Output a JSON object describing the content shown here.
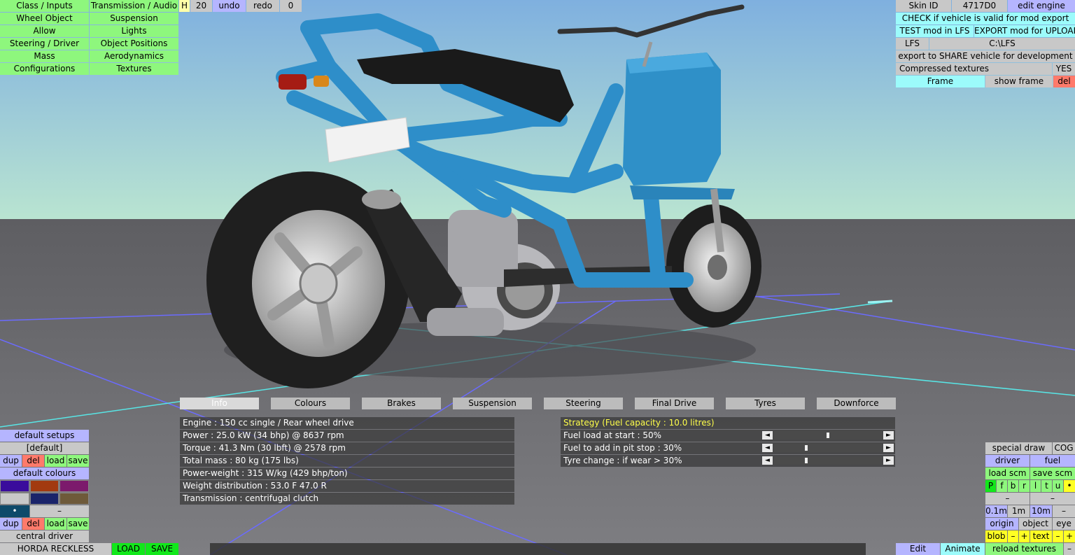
{
  "toolbar_left": {
    "rows": [
      [
        "Class / Inputs",
        "Transmission / Audio"
      ],
      [
        "Wheel Object",
        "Suspension"
      ],
      [
        "Allow",
        "Lights"
      ],
      [
        "Steering / Driver",
        "Object Positions"
      ],
      [
        "Mass",
        "Aerodynamics"
      ],
      [
        "Configurations",
        "Textures"
      ]
    ],
    "h_label": "H",
    "num_label": "20",
    "undo_label": "undo",
    "redo_label": "redo",
    "zero_label": "0"
  },
  "toolbar_right": {
    "skin_id_label": "Skin ID",
    "skin_id_value": "4717D0",
    "edit_engine": "edit engine",
    "check_valid": "CHECK if vehicle is valid for mod export",
    "test_mod": "TEST mod in LFS",
    "export_mod": "EXPORT mod for UPLOAD",
    "lfs_label": "LFS",
    "lfs_path": "C:\\LFS",
    "export_share": "export to SHARE vehicle for development",
    "compressed_textures": "Compressed textures",
    "compressed_value": "YES",
    "frame": "Frame",
    "show_frame": "show frame",
    "del": "del"
  },
  "info_tabs": [
    "Info",
    "Colours",
    "Brakes",
    "Suspension",
    "Steering",
    "Final Drive",
    "Tyres",
    "Downforce"
  ],
  "info_rows": [
    "Engine : 150 cc single / Rear wheel drive",
    "Power : 25.0 kW (34 bhp) @ 8637 rpm",
    "Torque : 41.3 Nm (30 lbft) @ 2578 rpm",
    "Total mass : 80 kg (175 lbs)",
    "Power-weight : 315 W/kg (429 bhp/ton)",
    "Weight distribution : 53.0 F  47.0 R",
    "Transmission : centrifugal clutch"
  ],
  "strategy": {
    "title": "Strategy (Fuel capacity : 10.0 litres)",
    "rows": [
      {
        "label": "Fuel load at start : 50%",
        "value": 0.5
      },
      {
        "label": "Fuel to add in pit stop : 30%",
        "value": 0.3
      },
      {
        "label": "Tyre change : if wear > 30%",
        "value": 0.3
      }
    ],
    "left_arrow": "◄",
    "right_arrow": "►"
  },
  "bottom_left": {
    "default_setups": "default setups",
    "default_setup_name": "[default]",
    "dup": "dup",
    "del": "del",
    "load": "load",
    "save": "save",
    "default_colours": "default colours",
    "swatches": [
      "#3a0c9c",
      "#a23a10",
      "#7c1a6c",
      "#c8c8c8",
      "#1a246a",
      "#6e5a3a"
    ],
    "dot": "•",
    "dash": "–",
    "central_driver": "central driver",
    "vehicle_name": "HORDA RECKLESS",
    "load_big": "LOAD",
    "save_big": "SAVE"
  },
  "bottom_right": {
    "special_draw": "special draw",
    "cog": "COG",
    "driver": "driver",
    "fuel": "fuel",
    "load_scm": "load scm",
    "save_scm": "save scm",
    "letters": [
      "P",
      "f",
      "b",
      "r",
      "l",
      "t",
      "u"
    ],
    "dot": "•",
    "dash": "–",
    "step_01": "0.1m",
    "step_1": "1m",
    "step_10": "10m",
    "origin": "origin",
    "object": "object",
    "eye": "eye",
    "blob": "blob",
    "minus": "–",
    "plus": "+",
    "text": "text",
    "edit": "Edit",
    "animate": "Animate",
    "reload_textures": "reload textures"
  }
}
